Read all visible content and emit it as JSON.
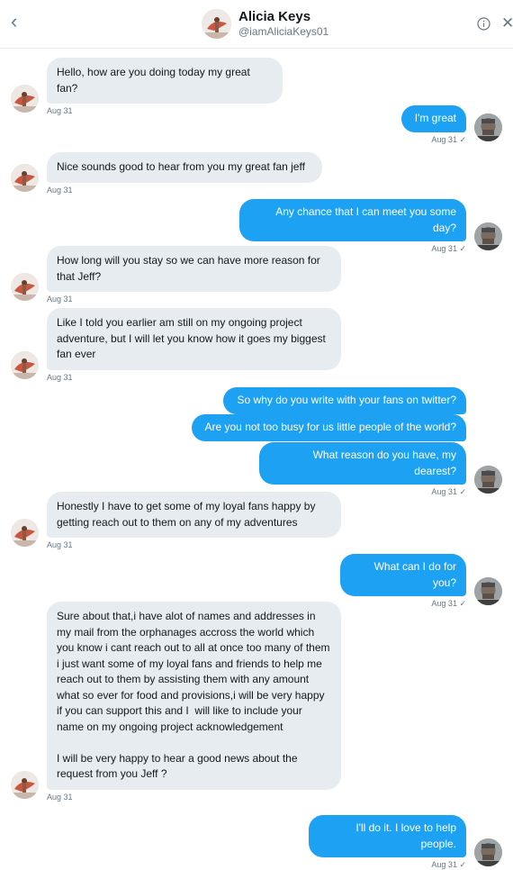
{
  "header": {
    "name": "Alicia Keys",
    "handle": "@iamAliciaKeys01",
    "back_icon": "chevron-left-icon",
    "info_icon": "info-icon",
    "close_icon": "close-icon"
  },
  "messages": [
    {
      "side": "in",
      "text": "Hello, how are you doing today my great fan?",
      "time": "Aug 31"
    },
    {
      "side": "out",
      "text": "I'm great",
      "time": "Aug 31 ✓"
    },
    {
      "side": "in",
      "text": "Nice sounds good to hear from you my great fan jeff",
      "time": "Aug 31"
    },
    {
      "side": "out",
      "text": "Any chance that I can meet you some day?",
      "time": "Aug 31 ✓"
    },
    {
      "side": "in",
      "text": "How long will you stay so we can have more reason for that Jeff?",
      "time": "Aug 31"
    },
    {
      "side": "in",
      "text": "Like I told you earlier am still on my ongoing project adventure, but I will let you know how it goes my biggest fan ever",
      "time": "Aug 31"
    },
    {
      "side": "out",
      "text": "So why do you write with your fans on twitter?",
      "time": ""
    },
    {
      "side": "out",
      "text": "Are you not too busy for us little people of the world?",
      "time": ""
    },
    {
      "side": "out",
      "text": "What reason do you have, my dearest?",
      "time": "Aug 31 ✓"
    },
    {
      "side": "in",
      "text": "Honestly I have to get some of my loyal fans happy by getting reach out to them on any of my adventures",
      "time": "Aug 31"
    },
    {
      "side": "out",
      "text": "What can I do for you?",
      "time": "Aug 31 ✓"
    },
    {
      "side": "in",
      "text": "Sure about that,i have alot of names and addresses in my mail from the orphanages accross the world which you know i cant reach out to all at once too many of them i just want some of my loyal fans and friends to help me reach out to them by assisting them with any amount what so ever for food and provisions,i will be very happy if you can support this and I  will like to include your name on my ongoing project acknowledgement\n\nI will be very happy to hear a good news about the request from you Jeff ?",
      "time": "Aug 31"
    },
    {
      "side": "out",
      "text": "I'll do it. I love to help people.",
      "time": "Aug 31 ✓"
    }
  ]
}
